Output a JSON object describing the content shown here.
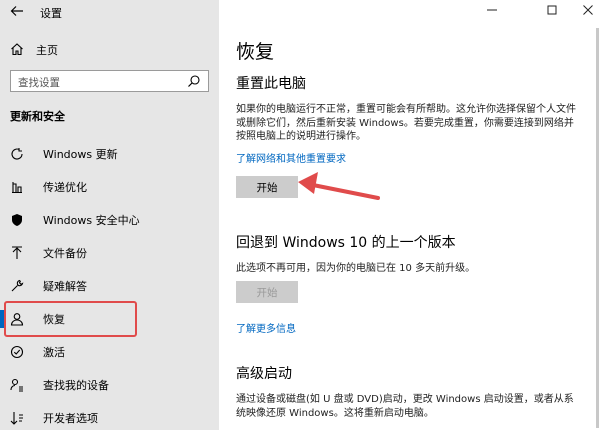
{
  "app": {
    "title": "设置"
  },
  "sidebar": {
    "home": "主页",
    "search_placeholder": "查找设置",
    "section": "更新和安全",
    "items": [
      {
        "label": "Windows 更新",
        "icon": "refresh-icon"
      },
      {
        "label": "传递优化",
        "icon": "delivery-optimization-icon"
      },
      {
        "label": "Windows 安全中心",
        "icon": "shield-icon"
      },
      {
        "label": "文件备份",
        "icon": "backup-arrow-icon"
      },
      {
        "label": "疑难解答",
        "icon": "wrench-icon"
      },
      {
        "label": "恢复",
        "icon": "recovery-icon"
      },
      {
        "label": "激活",
        "icon": "check-circle-icon"
      },
      {
        "label": "查找我的设备",
        "icon": "person-find-icon"
      },
      {
        "label": "开发者选项",
        "icon": "developer-icon"
      }
    ]
  },
  "main": {
    "title": "恢复",
    "reset": {
      "heading": "重置此电脑",
      "description": "如果你的电脑运行不正常，重置可能会有所帮助。这允许你选择保留个人文件或删除它们，然后重新安装 Windows。若要完成重置，你需要连接到网络并按照电脑上的说明进行操作。",
      "link": "了解网络和其他重置要求",
      "button": "开始"
    },
    "rollback": {
      "heading": "回退到 Windows 10 的上一个版本",
      "description": "此选项不再可用，因为你的电脑已在 10 多天前升级。",
      "button": "开始",
      "link": "了解更多信息"
    },
    "advanced": {
      "heading": "高级启动",
      "description": "通过设备或磁盘(如 U 盘或 DVD)启动，更改 Windows 启动设置，或者从系统映像还原 Windows。这将重新启动电脑。"
    }
  },
  "colors": {
    "accent": "#0067c0",
    "annotation": "#e04b4b",
    "sidebar_bg": "#e6e6e6"
  }
}
